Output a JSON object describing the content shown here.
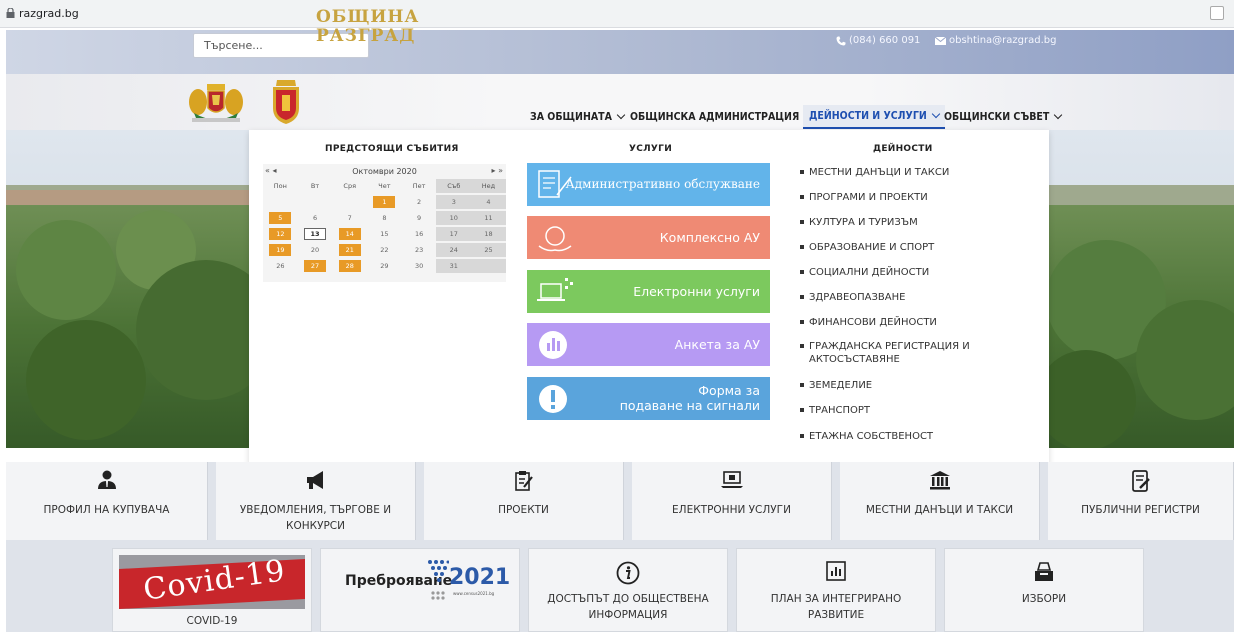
{
  "browser": {
    "url": "razgrad.bg"
  },
  "topbar": {
    "search_placeholder": "Търсене...",
    "phone": "(084) 660 091",
    "email": "obshtina@razgrad.bg"
  },
  "logo": {
    "line1": "ОБЩИНА",
    "line2": "РАЗГРАД"
  },
  "nav": [
    {
      "label": "ЗА ОБЩИНАТА"
    },
    {
      "label": "ОБЩИНСКА АДМИНИСТРАЦИЯ"
    },
    {
      "label": "ДЕЙНОСТИ И УСЛУГИ",
      "active": true
    },
    {
      "label": "ОБЩИНСКИ СЪВЕТ"
    }
  ],
  "mega": {
    "events_title": "ПРЕДСТОЯЩИ СЪБИТИЯ",
    "services_title": "УСЛУГИ",
    "activities_title": "ДЕЙНОСТИ",
    "calendar": {
      "prev": "« ◂",
      "next": "▸ »",
      "month": "Октомври 2020",
      "weekdays": [
        "Пон",
        "Вт",
        "Сря",
        "Чет",
        "Пет",
        "Съб",
        "Нед"
      ],
      "weeks": [
        [
          "",
          "",
          "",
          "1",
          "2",
          "3",
          "4"
        ],
        [
          "5",
          "6",
          "7",
          "8",
          "9",
          "10",
          "11"
        ],
        [
          "12",
          "13",
          "14",
          "15",
          "16",
          "17",
          "18"
        ],
        [
          "19",
          "20",
          "21",
          "22",
          "23",
          "24",
          "25"
        ],
        [
          "26",
          "27",
          "28",
          "29",
          "30",
          "31",
          ""
        ]
      ],
      "event_days": [
        "1",
        "5",
        "12",
        "14",
        "19",
        "21",
        "27",
        "28"
      ],
      "today": "13"
    },
    "services": [
      {
        "label": "Административно обслужване",
        "color": "#62b4ea"
      },
      {
        "label": "Комплексно АУ",
        "color": "#ef8a74"
      },
      {
        "label": "Електронни услуги",
        "color": "#7cc95e"
      },
      {
        "label": "Анкета за АУ",
        "color": "#b69af3"
      },
      {
        "label_line1": "Форма за",
        "label_line2": "подаване на сигнали",
        "color": "#5aa4dc"
      }
    ],
    "activities": [
      "МЕСТНИ ДАНЪЦИ И ТАКСИ",
      "ПРОГРАМИ И ПРОЕКТИ",
      "КУЛТУРА И ТУРИЗЪМ",
      "ОБРАЗОВАНИЕ И СПОРТ",
      "СОЦИАЛНИ ДЕЙНОСТИ",
      "ЗДРАВЕОПАЗВАНЕ",
      "ФИНАНСОВИ ДЕЙНОСТИ",
      "ГРАЖДАНСКА РЕГИСТРАЦИЯ И",
      "АКТОСЪСТАВЯНЕ",
      "ЗЕМЕДЕЛИЕ",
      "ТРАНСПОРТ",
      "ЕТАЖНА СОБСТВЕНОСТ"
    ]
  },
  "tiles_row1": [
    {
      "line1": "ПРОФИЛ НА КУПУВАЧА",
      "line2": "",
      "icon": "user-tie-icon"
    },
    {
      "line1": "УВЕДОМЛЕНИЯ, ТЪРГОВЕ И",
      "line2": "КОНКУРСИ",
      "icon": "megaphone-icon"
    },
    {
      "line1": "ПРОЕКТИ",
      "line2": "",
      "icon": "clipboard-edit-icon"
    },
    {
      "line1": "ЕЛЕКТРОННИ УСЛУГИ",
      "line2": "",
      "icon": "laptop-icon"
    },
    {
      "line1": "МЕСТНИ ДАНЪЦИ И ТАКСИ",
      "line2": "",
      "icon": "bank-icon"
    },
    {
      "line1": "ПУБЛИЧНИ РЕГИСТРИ",
      "line2": "",
      "icon": "document-edit-icon"
    }
  ],
  "tiles_row2": {
    "covid_banner": "Covid-19",
    "covid_caption": "COVID-19",
    "census_word": "Преброяване",
    "census_year": "2021",
    "census_url": "www.census2021.bg",
    "access_line1": "ДОСТЪПЪТ ДО ОБЩЕСТВЕНА",
    "access_line2": "ИНФОРМАЦИЯ",
    "plan_line1": "ПЛАН ЗА ИНТЕГРИРАНО",
    "plan_line2": "РАЗВИТИЕ",
    "elections": "ИЗБОРИ"
  }
}
